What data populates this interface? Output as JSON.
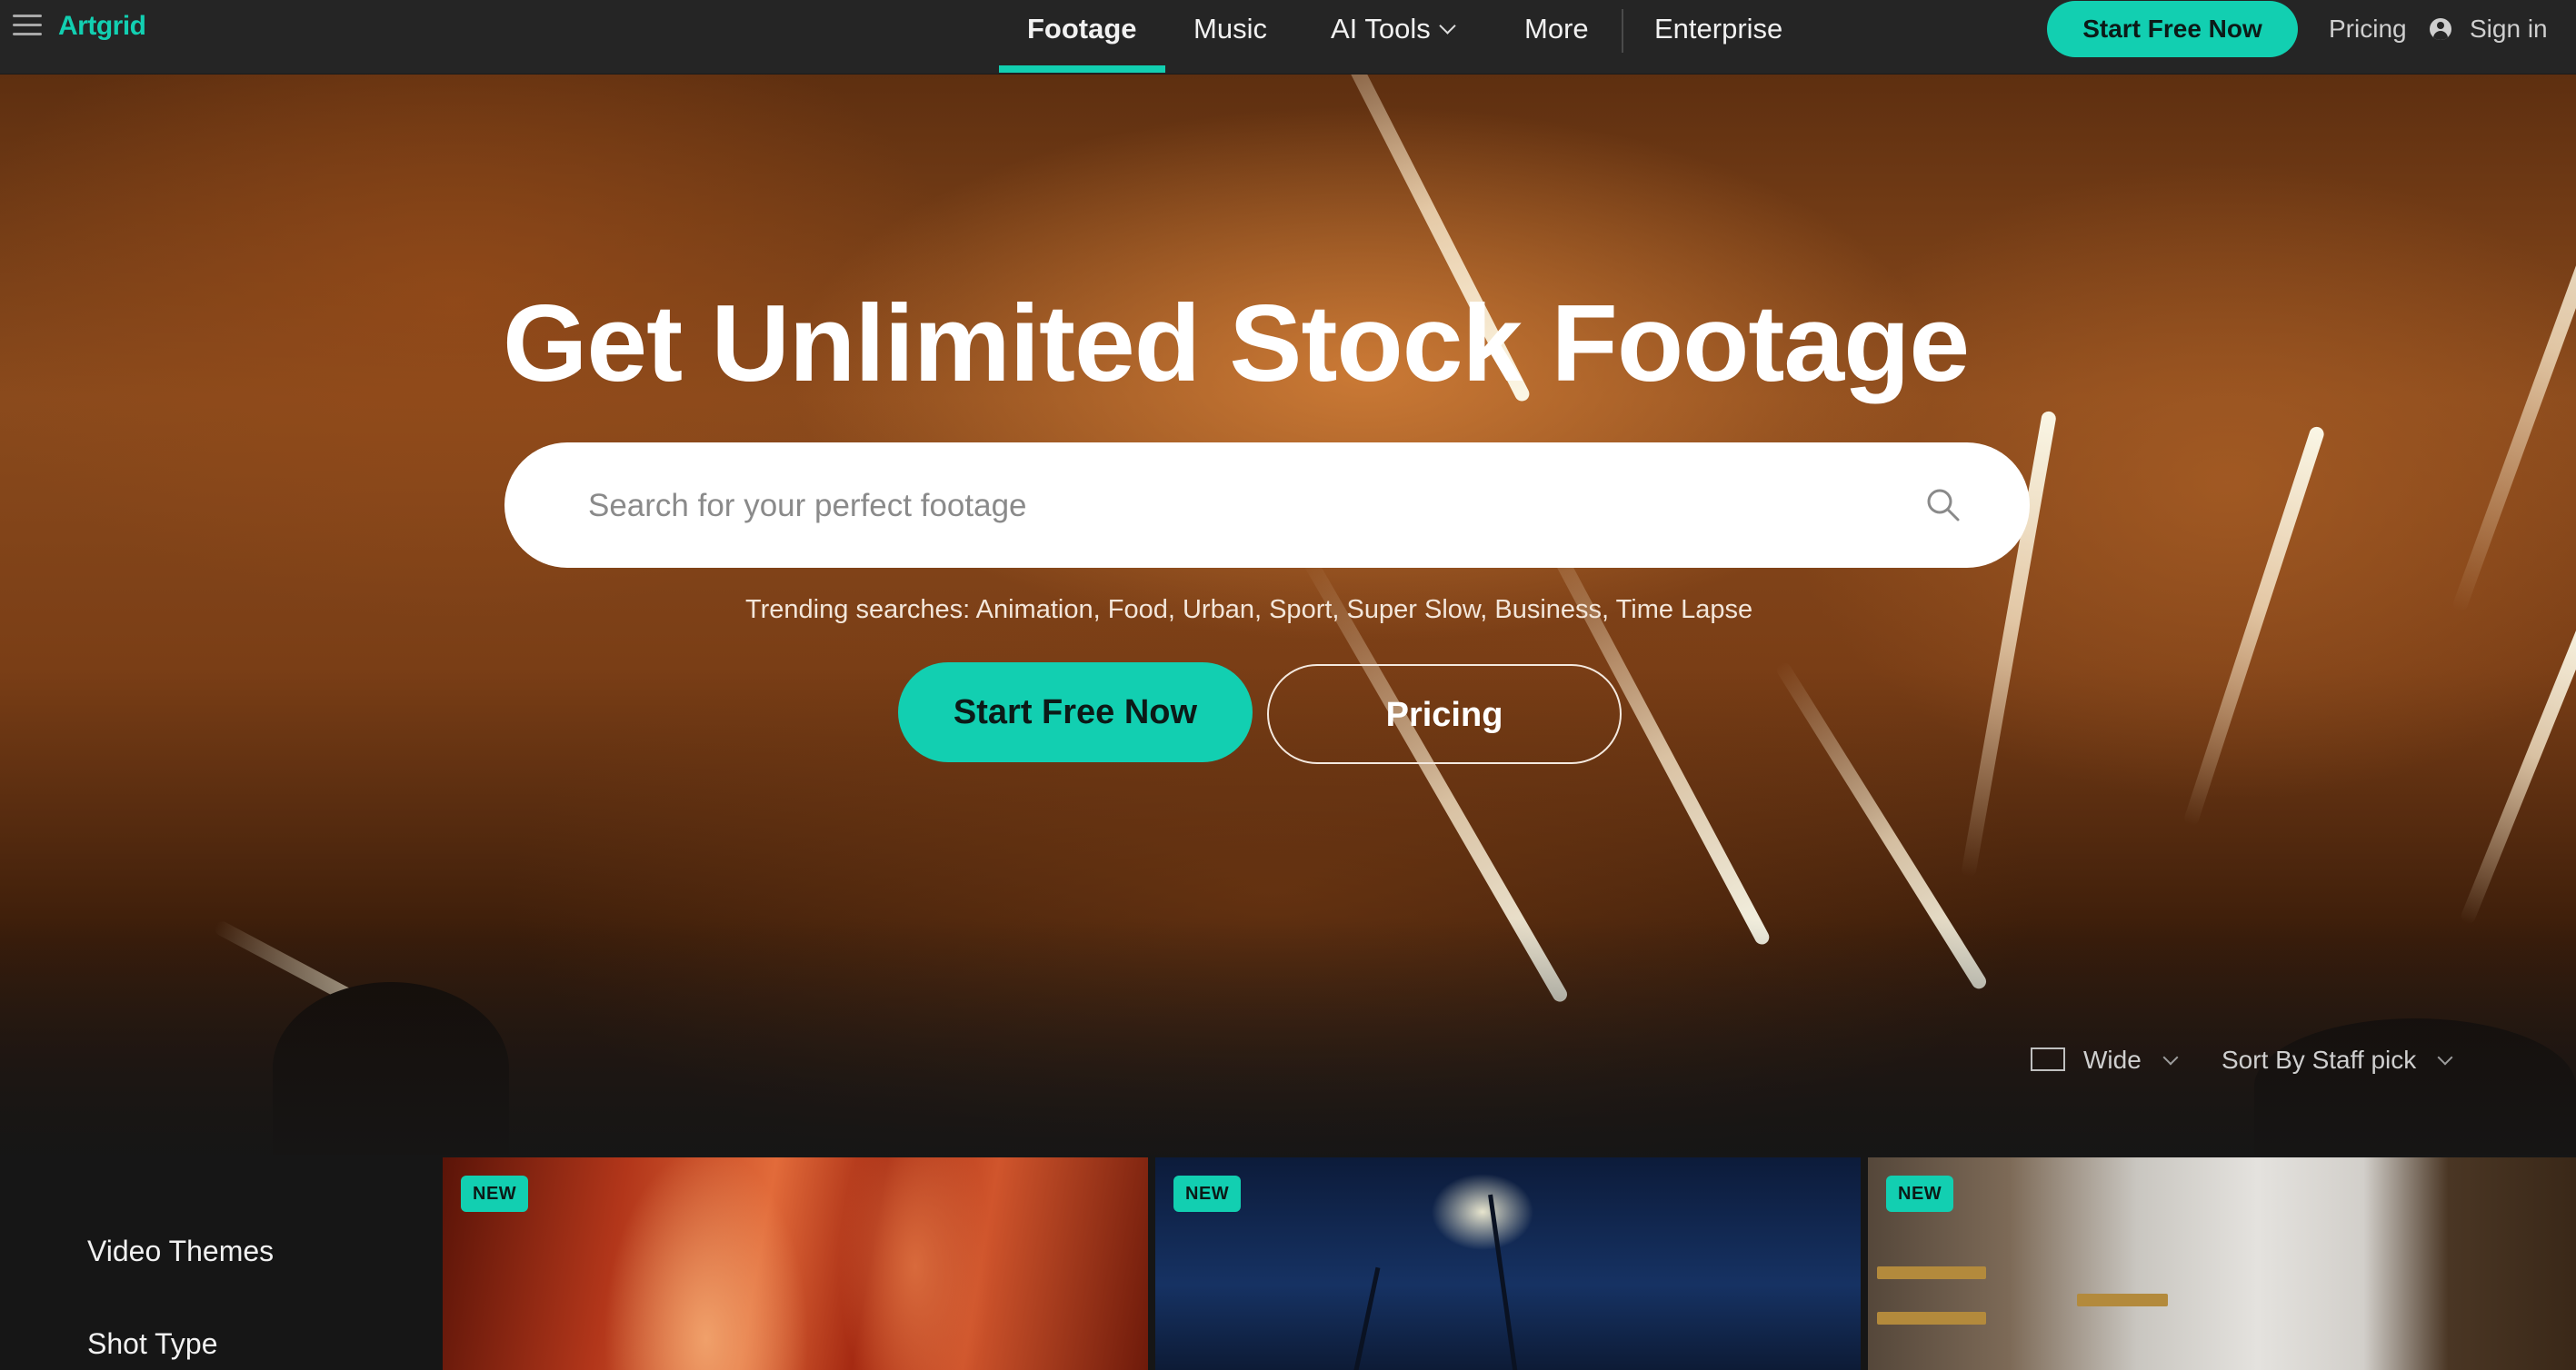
{
  "nav": {
    "logo": "Artgrid",
    "links": [
      "Footage",
      "Music",
      "AI Tools",
      "More",
      "Enterprise"
    ],
    "active": "Footage",
    "cta": "Start Free Now",
    "pricing": "Pricing",
    "signin": "Sign in"
  },
  "hero": {
    "title": "Get Unlimited Stock Footage",
    "search_placeholder": "Search for your perfect footage",
    "trending_label": "Trending searches:",
    "trending_terms": [
      "Animation",
      "Food",
      "Urban",
      "Sport",
      "Super Slow",
      "Business",
      "Time Lapse"
    ],
    "cta": "Start Free Now",
    "pricing": "Pricing"
  },
  "controls": {
    "view": "Wide",
    "sort": "Sort By Staff pick"
  },
  "sidebar": {
    "items": [
      "Video Themes",
      "Shot Type"
    ]
  },
  "clips": [
    {
      "badge": "NEW"
    },
    {
      "badge": "NEW"
    },
    {
      "badge": "NEW"
    }
  ],
  "colors": {
    "accent": "#12cfb1",
    "nav_bg": "#252525",
    "page_bg": "#161616"
  }
}
